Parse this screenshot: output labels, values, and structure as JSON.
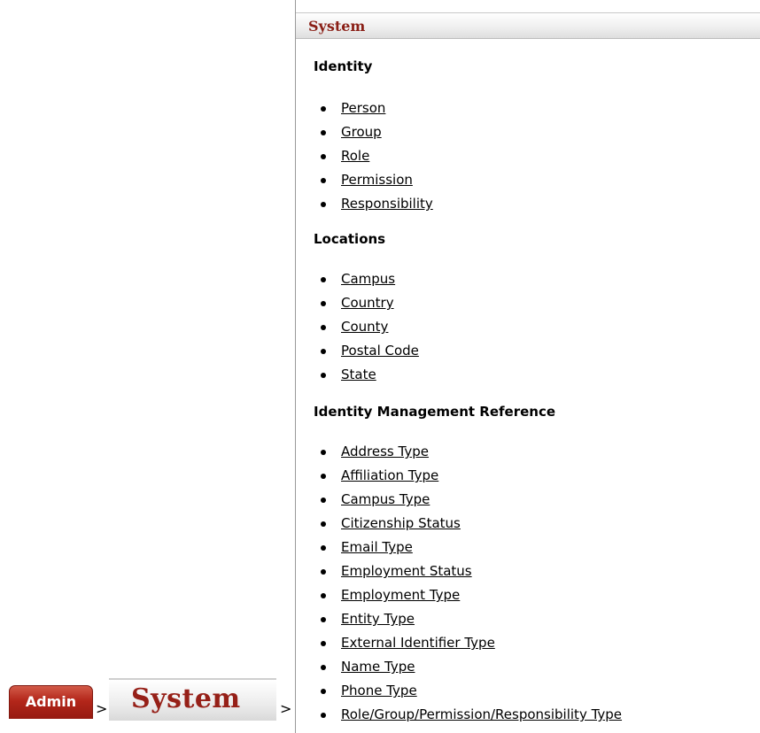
{
  "breadcrumb": {
    "admin_label": "Admin",
    "separator": ">",
    "system_label": "System"
  },
  "panel": {
    "title": "System",
    "sections": [
      {
        "title": "Identity",
        "links": [
          "Person",
          "Group",
          "Role",
          "Permission",
          "Responsibility"
        ]
      },
      {
        "title": "Locations",
        "links": [
          "Campus",
          "Country",
          "County",
          "Postal Code",
          "State"
        ]
      },
      {
        "title": "Identity Management Reference",
        "links": [
          "Address Type",
          "Affiliation Type",
          "Campus Type",
          "Citizenship Status",
          "Email Type",
          "Employment Status",
          "Employment Type",
          "Entity Type",
          "External Identifier Type",
          "Name Type",
          "Phone Type",
          "Role/Group/Permission/Responsibility Type"
        ]
      }
    ]
  },
  "colors": {
    "admin_tab": "#b3261a",
    "system_text": "#962018",
    "panel_title": "#8a1f16"
  }
}
